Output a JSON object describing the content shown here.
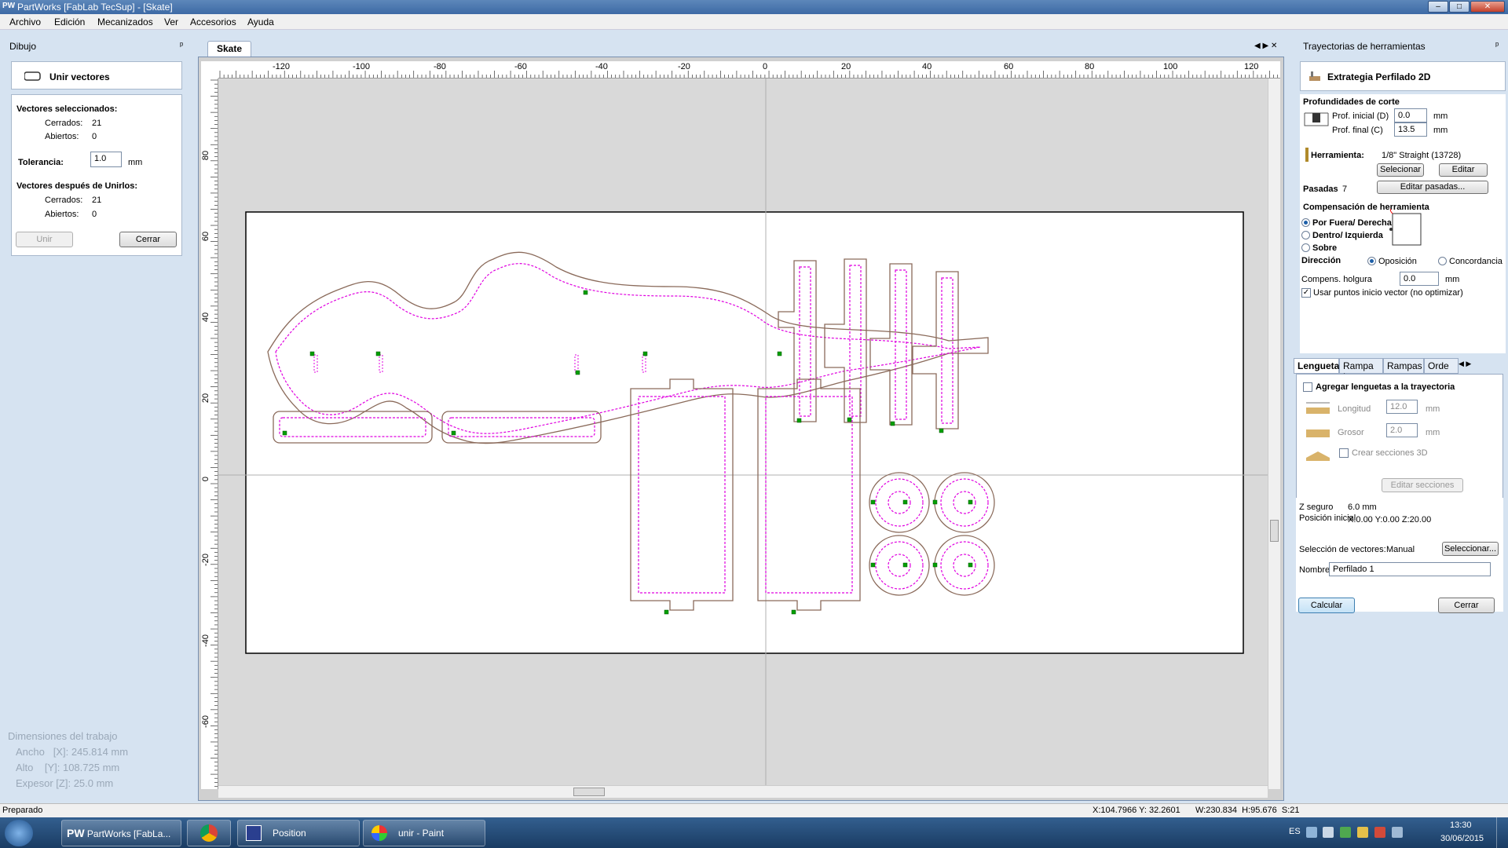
{
  "window": {
    "title": "PartWorks [FabLab TecSup] - [Skate]",
    "app_badge": "PW",
    "btn_min": "–",
    "btn_max": "□",
    "btn_close": "✕"
  },
  "menu": [
    "Archivo",
    "Edición",
    "Mecanizados",
    "Ver",
    "Accesorios",
    "Ayuda"
  ],
  "left_panel": {
    "header": "Dibujo",
    "pin": "ᵖ",
    "tool_title": "Unir vectores",
    "selected_heading": "Vectores seleccionados:",
    "closed_label": "Cerrados:",
    "closed_value": "21",
    "open_label": "Abiertos:",
    "open_value": "0",
    "tolerance_label": "Tolerancia:",
    "tolerance_value": "1.0",
    "tolerance_unit": "mm",
    "after_heading": "Vectores después de Unirlos:",
    "after_closed_label": "Cerrados:",
    "after_closed_value": "21",
    "after_open_label": "Abiertos:",
    "after_open_value": "0",
    "join_button": "Unir",
    "close_button": "Cerrar",
    "job_dims_title": "Dimensiones del trabajo",
    "width_line": "Ancho   [X]: 245.814 mm",
    "height_line": "Alto    [Y]: 108.725 mm",
    "thickness_line": "Expesor [Z]: 25.0 mm"
  },
  "document": {
    "tab": "Skate",
    "ruler_x_labels": [
      "-120",
      "-100",
      "-80",
      "-60",
      "-40",
      "-20",
      "0",
      "20",
      "40",
      "60",
      "80",
      "100",
      "120"
    ],
    "ruler_y_labels": [
      "80",
      "60",
      "40",
      "20",
      "0",
      "-20",
      "-40",
      "-60"
    ]
  },
  "right_panel": {
    "header": "Trayectorias de herramientas",
    "pin": "ᵖ",
    "strategy_title": "Extrategia Perfilado 2D",
    "depths_heading": "Profundidades de corte",
    "start_depth_label": "Prof. inicial (D)",
    "start_depth_value": "0.0",
    "start_depth_unit": "mm",
    "final_depth_label": "Prof. final (C)",
    "final_depth_value": "13.5",
    "final_depth_unit": "mm",
    "tool_label": "Herramienta:",
    "tool_value": "1/8\" Straight (13728)",
    "select_button": "Selecionar",
    "edit_button": "Editar",
    "passes_label": "Pasadas",
    "passes_value": "7",
    "edit_passes_button": "Editar pasadas...",
    "compensation_heading": "Compensación de herramienta",
    "comp_outside": "Por Fuera/ Derecha",
    "comp_inside": "Dentro/ Izquierda",
    "comp_on": "Sobre",
    "direction_label": "Dirección",
    "dir_climb": "Oposición",
    "dir_conventional": "Concordancia",
    "allowance_label": "Compens. holgura",
    "allowance_value": "0.0",
    "allowance_unit": "mm",
    "use_start_points": "Usar puntos inicio vector (no optimizar)",
    "tabs": [
      "Lenguetas",
      "Rampa L.",
      "Rampas",
      "Orde"
    ],
    "add_tabs_label": "Agregar lenguetas a la trayectoria",
    "length_label": "Longitud",
    "length_value": "12.0",
    "length_unit": "mm",
    "thickness_label": "Grosor",
    "thickness_value": "2.0",
    "thickness_unit": "mm",
    "create_3d_label": "Crear secciones 3D",
    "edit_sections_button": "Editar secciones",
    "safe_z_label": "Z seguro",
    "safe_z_value": "6.0 mm",
    "home_label": "Posición inicial",
    "home_value": "X:0.00 Y:0.00 Z:20.00",
    "vector_sel_label": "Selección de vectores:",
    "vector_sel_value": "Manual",
    "vector_sel_button": "Seleccionar...",
    "name_label": "Nombre:",
    "name_value": "Perfilado 1",
    "calculate_button": "Calcular",
    "close_button": "Cerrar"
  },
  "status_bar": {
    "left": "Preparado",
    "coords": "X:104.7966 Y: 32.2601",
    "size": "W:230.834  H:95.676  S:21"
  },
  "taskbar": {
    "items": [
      "PartWorks [FabLa...",
      "",
      "Position",
      "unir - Paint"
    ],
    "lang": "ES",
    "time": "13:30",
    "date": "30/06/2015"
  },
  "colors": {
    "toolpath": "#e000e0",
    "vector": "#8a6a5a",
    "node": "#00a000",
    "accent": "#1d5fa8"
  }
}
